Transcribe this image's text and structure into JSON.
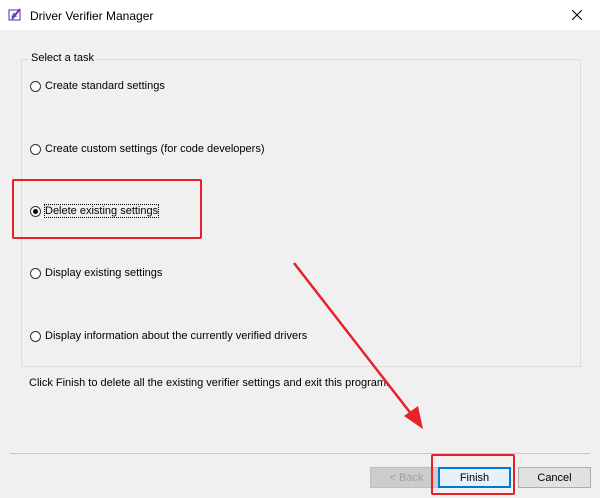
{
  "window": {
    "title": "Driver Verifier Manager"
  },
  "group": {
    "label": "Select a task"
  },
  "options": [
    {
      "label": "Create standard settings",
      "checked": false
    },
    {
      "label": "Create custom settings (for code developers)",
      "checked": false
    },
    {
      "label": "Delete existing settings",
      "checked": true
    },
    {
      "label": "Display existing settings",
      "checked": false
    },
    {
      "label": "Display information about the currently verified drivers",
      "checked": false
    }
  ],
  "description": "Click Finish to delete all the existing verifier settings and exit this program.",
  "buttons": {
    "back": "< Back",
    "finish": "Finish",
    "cancel": "Cancel"
  },
  "colors": {
    "annotation": "#e8202a",
    "default_button_border": "#0078d7"
  }
}
